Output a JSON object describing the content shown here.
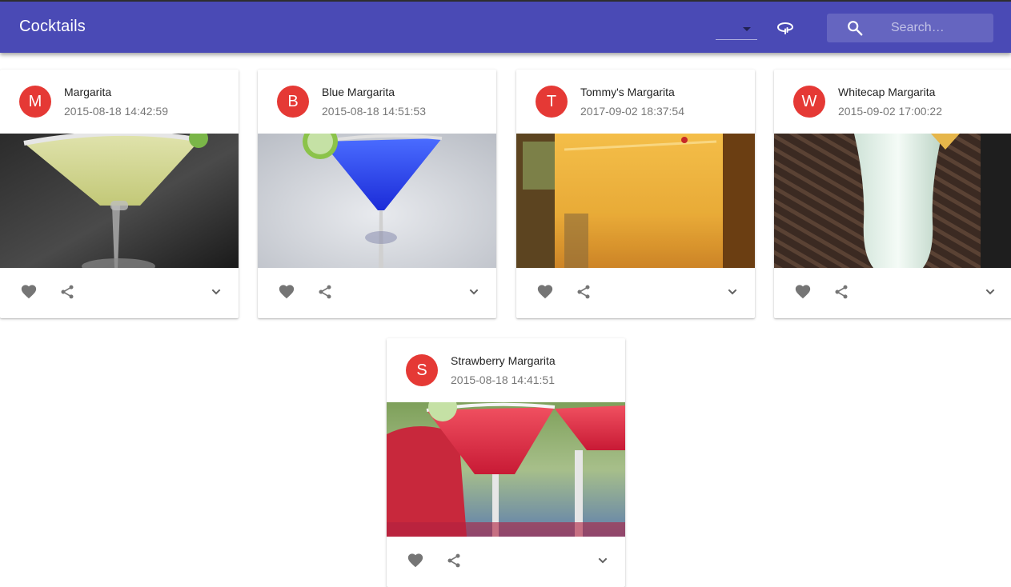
{
  "app": {
    "title": "Cocktails"
  },
  "toolbar": {
    "select_value": "",
    "search_placeholder": "Search…"
  },
  "colors": {
    "appbar": "#4a4ab5",
    "avatar": "#e53935"
  },
  "icons": {
    "search": "search-icon",
    "loop": "loop-icon",
    "favorite": "heart-icon",
    "share": "share-icon",
    "expand": "chevron-down-icon"
  },
  "cards": [
    {
      "initial": "M",
      "title": "Margarita",
      "date": "2015-08-18 14:42:59"
    },
    {
      "initial": "B",
      "title": "Blue Margarita",
      "date": "2015-08-18 14:51:53"
    },
    {
      "initial": "T",
      "title": "Tommy's Margarita",
      "date": "2017-09-02 18:37:54"
    },
    {
      "initial": "W",
      "title": "Whitecap Margarita",
      "date": "2015-09-02 17:00:22"
    },
    {
      "initial": "S",
      "title": "Strawberry Margarita",
      "date": "2015-08-18 14:41:51"
    }
  ]
}
